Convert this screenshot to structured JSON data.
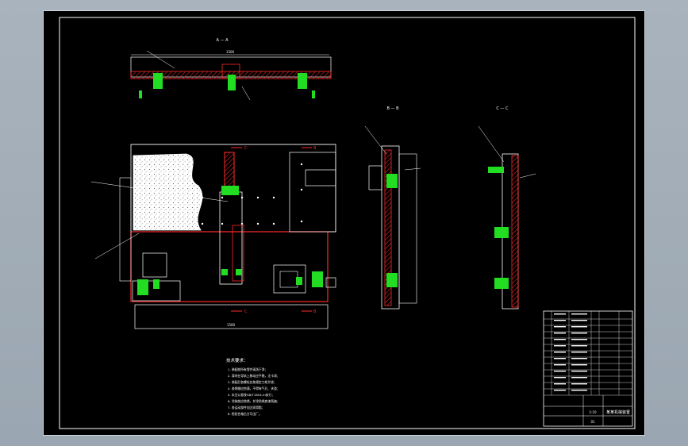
{
  "sheet": {
    "background": "#000000",
    "frame_color": "#ffffff",
    "section_color": "#ff2a2a",
    "fastener_color": "#22dd22"
  },
  "views": {
    "section_a_label": "A — A",
    "section_b_label": "B — B",
    "section_c_label": "C — C",
    "mark_b_top": "B",
    "mark_b_bottom": "B",
    "mark_c_top": "C",
    "mark_c_bottom": "C",
    "dim_main_width": "1500"
  },
  "notes": {
    "title": "技术要求：",
    "lines": [
      "1. 装配前所有零件清洗干净；",
      "2. 滑块在导轨上移动应平稳，无卡滞；",
      "3. 装配后各螺栓应按规定力矩拧紧；",
      "4. 各焊缝应饱满，不得有气孔、夹渣；",
      "5. 未注公差按GB/T1804-m执行；",
      "6. 涂装前应除锈，并涂防锈底漆两遍；",
      "7. 各运动部件加注润滑脂；",
      "8. 检验合格后方可出厂。"
    ]
  },
  "title_block": {
    "drawing_name": "某某机械装置",
    "scale": "1:10",
    "sheet_no": "01"
  }
}
